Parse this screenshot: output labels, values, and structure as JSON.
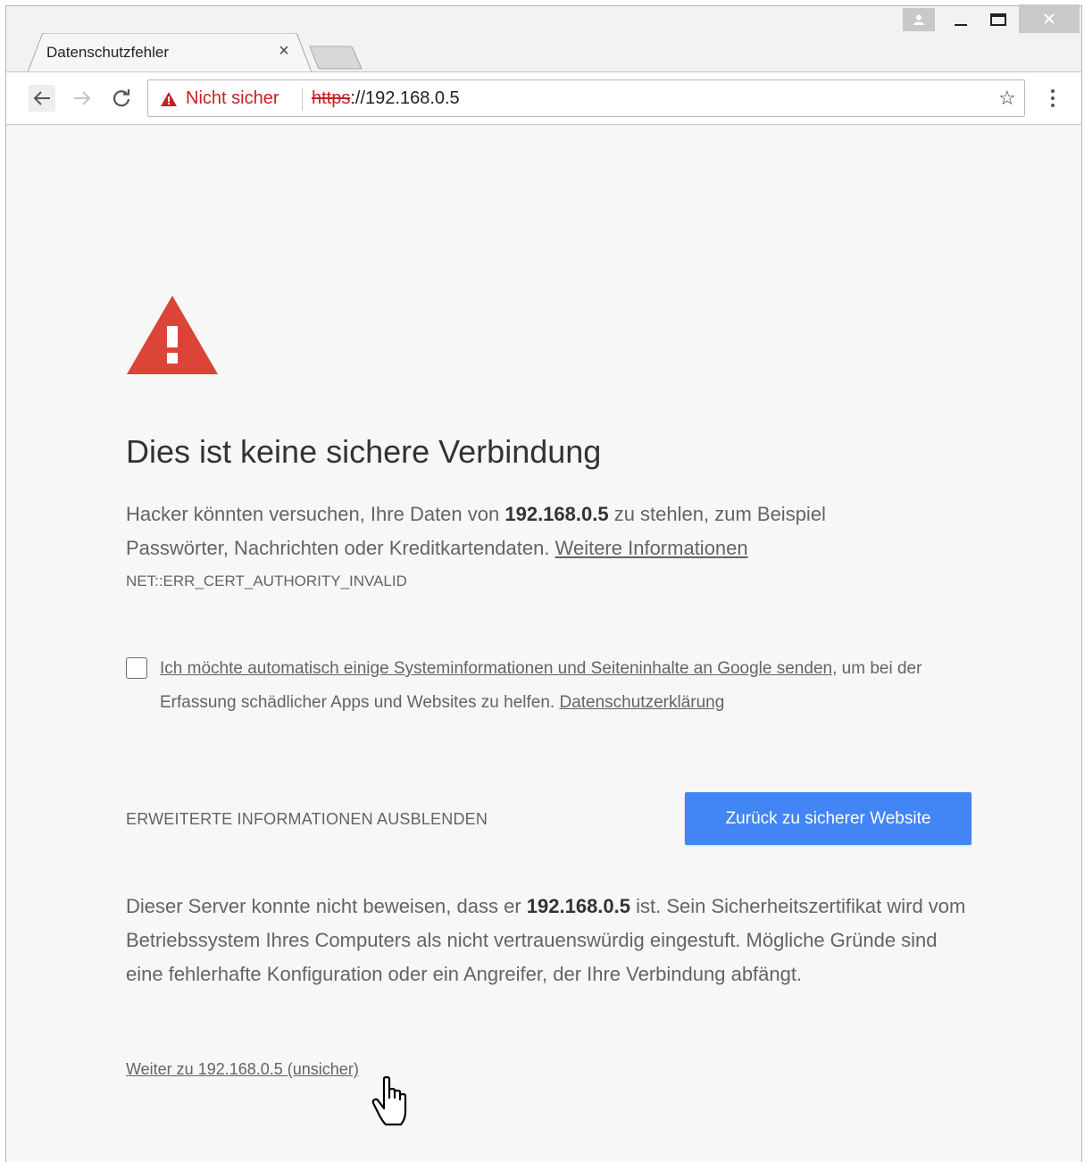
{
  "tab": {
    "title": "Datenschutzfehler",
    "close_glyph": "×"
  },
  "window_controls": {
    "profile": "profile-icon",
    "minimize": "minimize-icon",
    "maximize": "maximize-icon",
    "close": "close-icon"
  },
  "toolbar": {
    "back": "back-arrow-icon",
    "forward": "forward-arrow-icon",
    "reload": "reload-icon",
    "omnibox": {
      "security_label": "Nicht sicher",
      "url_scheme": "https",
      "url_rest": "://192.168.0.5",
      "bookmark_glyph": "☆"
    }
  },
  "page": {
    "heading": "Dies ist keine sichere Verbindung",
    "para1": {
      "before": "Hacker könnten versuchen, Ihre Daten von ",
      "host": "192.168.0.5",
      "after": " zu stehlen, zum Beispiel Passwörter, Nachrichten oder Kreditkartendaten. ",
      "link": "Weitere Informationen"
    },
    "error_code": "NET::ERR_CERT_AUTHORITY_INVALID",
    "checkbox": {
      "checked": false,
      "link": "Ich möchte automatisch einige Systeminformationen und Seiteninhalte an Google senden",
      "after": ", um bei der Erfassung schädlicher Apps und Websites zu helfen. ",
      "privacy_link": "Datenschutzerklärung"
    },
    "advanced_toggle": "ERWEITERTE INFORMATIONEN AUSBLENDEN",
    "primary_button": "Zurück zu sicherer Website",
    "para2": {
      "before": "Dieser Server konnte nicht beweisen, dass er ",
      "host": "192.168.0.5",
      "after": " ist. Sein Sicherheitszertifikat wird vom Betriebssystem Ihres Computers als nicht vertrauenswürdig eingestuft. Mögliche Gründe sind eine fehlerhafte Konfiguration oder ein Angreifer, der Ihre Verbindung abfängt."
    },
    "proceed_link": "Weiter zu 192.168.0.5 (unsicher)"
  },
  "colors": {
    "danger": "#c5221f",
    "warning_triangle": "#db4437",
    "primary": "#4285f4",
    "text": "#646464",
    "background": "#f7f7f7"
  }
}
